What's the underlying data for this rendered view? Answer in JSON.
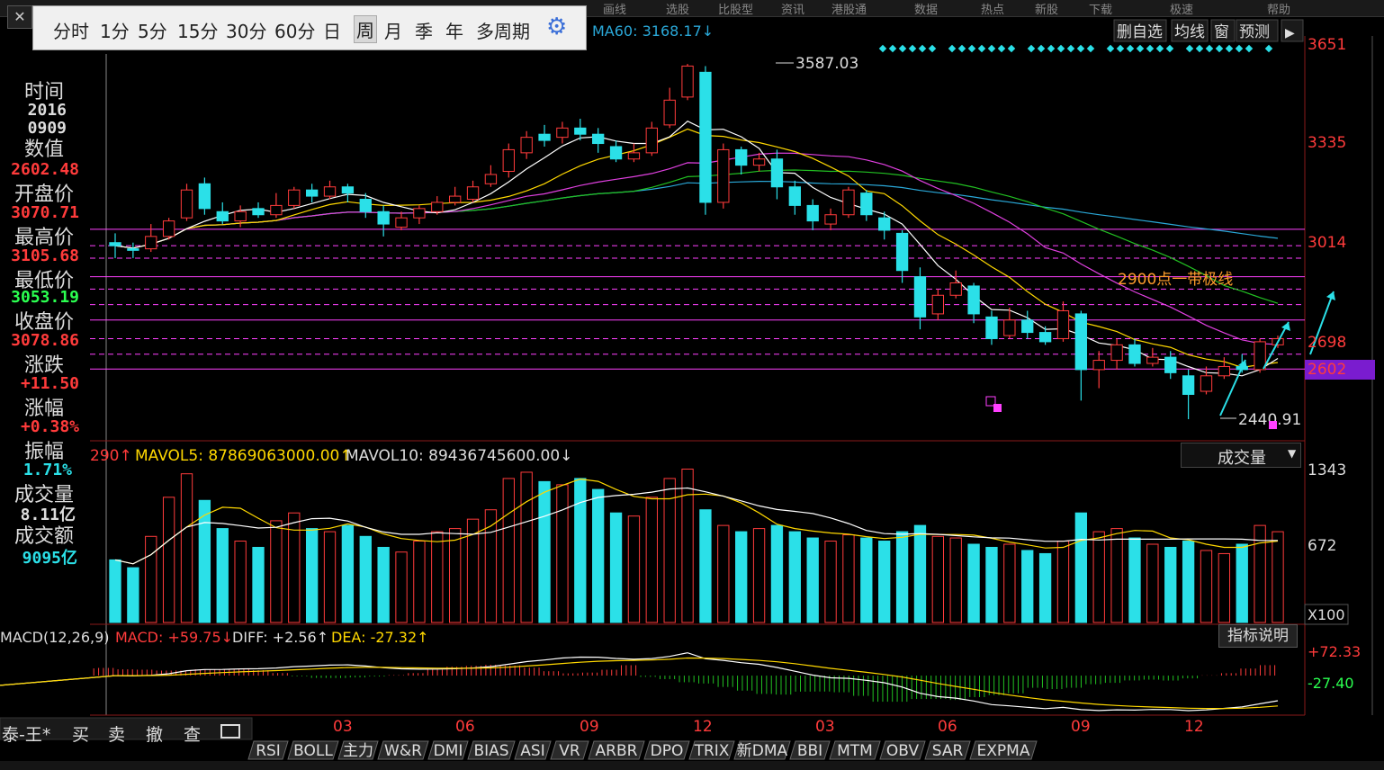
{
  "top_strip": [
    "画线",
    "选股",
    "比股型",
    "资讯",
    "港股通",
    "数据",
    "热点",
    "新股",
    "下载",
    "极速",
    "帮助"
  ],
  "period_bar": {
    "items": [
      "分时",
      "1分",
      "5分",
      "15分",
      "30分",
      "60分",
      "日",
      "周",
      "月",
      "季",
      "年",
      "多周期"
    ],
    "selected": "周",
    "settings_icon": "gear-icon",
    "close_icon": "close-icon"
  },
  "ma_header": {
    "ma60_label": "MA60: 3168.17↓"
  },
  "toolbar": {
    "del_select": "删自选",
    "avg_line": "均线",
    "window": "窗",
    "predict": "预测",
    "expand_icon": "expand-icon"
  },
  "info_panel": {
    "time_label": "时间",
    "year": "2016",
    "date": "0909",
    "value_label": "数值",
    "value": "2602.48",
    "open_label": "开盘价",
    "open": "3070.71",
    "high_label": "最高价",
    "high": "3105.68",
    "low_label": "最低价",
    "low": "3053.19",
    "close_label": "收盘价",
    "close": "3078.86",
    "change_label": "涨跌",
    "change": "+11.50",
    "pct_label": "涨幅",
    "pct": "+0.38%",
    "amp_label": "振幅",
    "amp": "1.71%",
    "vol_label": "成交量",
    "vol": "8.11亿",
    "amt_label": "成交额",
    "amt": "9095亿"
  },
  "price_axis": {
    "ticks": [
      "3651",
      "3335",
      "3014",
      "2698",
      "2602"
    ]
  },
  "annotations": {
    "peak": "3587.03",
    "trough": "2440.91",
    "zone_note": "2900点一带极线"
  },
  "volume_header": {
    "mavol_prev": "290↑",
    "mavol5": "MAVOL5: 87869063000.00↑",
    "mavol10": "MAVOL10: 89436745600.00↓"
  },
  "volume_axis": {
    "ticks": [
      "1343",
      "672"
    ],
    "unit": "X100",
    "selector": "成交量"
  },
  "macd_header": {
    "name": "MACD(12,26,9)",
    "macd": "MACD: +59.75↓",
    "diff": "DIFF: +2.56↑",
    "dea": "DEA: -27.32↑"
  },
  "macd_axis": {
    "ticks": [
      "+72.33",
      "-27.40"
    ],
    "explain": "指标说明"
  },
  "x_axis": {
    "labels": [
      "03",
      "06",
      "09",
      "12",
      "03",
      "06",
      "09",
      "12"
    ]
  },
  "order_bar": [
    "泰-王*",
    "买",
    "卖",
    "撤",
    "查"
  ],
  "indicator_tabs": [
    "RSI",
    "BOLL",
    "主力",
    "W&R",
    "DMI",
    "BIAS",
    "ASI",
    "VR",
    "ARBR",
    "DPO",
    "TRIX",
    "新DMA",
    "BBI",
    "MTM",
    "OBV",
    "SAR",
    "EXPMA"
  ],
  "colors": {
    "up": "#ff3b3b",
    "down": "#2be0e8",
    "ma5": "#ffffff",
    "ma10": "#ffd800",
    "ma20": "#e040e0",
    "ma30": "#22c022",
    "ma60": "#2aa8d8",
    "zone": "#ff40ff"
  },
  "chart_data": {
    "type": "candlestick",
    "title": "",
    "ylim": [
      2440,
      3651
    ],
    "price_levels": [
      3053.19,
      2698,
      2602
    ],
    "candles": [
      {
        "o": 3010,
        "c": 3000,
        "h": 3040,
        "l": 2960
      },
      {
        "o": 2990,
        "c": 2985,
        "h": 3010,
        "l": 2960
      },
      {
        "o": 2990,
        "c": 3030,
        "h": 3070,
        "l": 2980
      },
      {
        "o": 3030,
        "c": 3080,
        "h": 3090,
        "l": 3020
      },
      {
        "o": 3090,
        "c": 3180,
        "h": 3200,
        "l": 3080
      },
      {
        "o": 3200,
        "c": 3120,
        "h": 3220,
        "l": 3100
      },
      {
        "o": 3110,
        "c": 3080,
        "h": 3140,
        "l": 3070
      },
      {
        "o": 3080,
        "c": 3110,
        "h": 3130,
        "l": 3060
      },
      {
        "o": 3120,
        "c": 3100,
        "h": 3140,
        "l": 3090
      },
      {
        "o": 3100,
        "c": 3130,
        "h": 3170,
        "l": 3090
      },
      {
        "o": 3130,
        "c": 3180,
        "h": 3190,
        "l": 3120
      },
      {
        "o": 3180,
        "c": 3160,
        "h": 3200,
        "l": 3140
      },
      {
        "o": 3160,
        "c": 3190,
        "h": 3210,
        "l": 3150
      },
      {
        "o": 3190,
        "c": 3170,
        "h": 3200,
        "l": 3140
      },
      {
        "o": 3150,
        "c": 3110,
        "h": 3170,
        "l": 3090
      },
      {
        "o": 3110,
        "c": 3070,
        "h": 3130,
        "l": 3030
      },
      {
        "o": 3060,
        "c": 3090,
        "h": 3110,
        "l": 3050
      },
      {
        "o": 3090,
        "c": 3120,
        "h": 3130,
        "l": 3070
      },
      {
        "o": 3110,
        "c": 3140,
        "h": 3160,
        "l": 3100
      },
      {
        "o": 3140,
        "c": 3160,
        "h": 3190,
        "l": 3130
      },
      {
        "o": 3150,
        "c": 3190,
        "h": 3210,
        "l": 3140
      },
      {
        "o": 3200,
        "c": 3230,
        "h": 3260,
        "l": 3190
      },
      {
        "o": 3240,
        "c": 3310,
        "h": 3330,
        "l": 3220
      },
      {
        "o": 3300,
        "c": 3350,
        "h": 3370,
        "l": 3280
      },
      {
        "o": 3360,
        "c": 3340,
        "h": 3390,
        "l": 3320
      },
      {
        "o": 3350,
        "c": 3380,
        "h": 3400,
        "l": 3330
      },
      {
        "o": 3380,
        "c": 3360,
        "h": 3410,
        "l": 3340
      },
      {
        "o": 3360,
        "c": 3330,
        "h": 3380,
        "l": 3300
      },
      {
        "o": 3320,
        "c": 3280,
        "h": 3340,
        "l": 3270
      },
      {
        "o": 3280,
        "c": 3300,
        "h": 3330,
        "l": 3270
      },
      {
        "o": 3300,
        "c": 3380,
        "h": 3400,
        "l": 3290
      },
      {
        "o": 3390,
        "c": 3470,
        "h": 3510,
        "l": 3380
      },
      {
        "o": 3480,
        "c": 3580,
        "h": 3587,
        "l": 3470
      },
      {
        "o": 3560,
        "c": 3140,
        "h": 3580,
        "l": 3100
      },
      {
        "o": 3140,
        "c": 3310,
        "h": 3330,
        "l": 3120
      },
      {
        "o": 3310,
        "c": 3260,
        "h": 3320,
        "l": 3230
      },
      {
        "o": 3260,
        "c": 3280,
        "h": 3300,
        "l": 3240
      },
      {
        "o": 3280,
        "c": 3190,
        "h": 3310,
        "l": 3150
      },
      {
        "o": 3190,
        "c": 3130,
        "h": 3210,
        "l": 3100
      },
      {
        "o": 3130,
        "c": 3080,
        "h": 3150,
        "l": 3050
      },
      {
        "o": 3070,
        "c": 3100,
        "h": 3120,
        "l": 3050
      },
      {
        "o": 3100,
        "c": 3180,
        "h": 3190,
        "l": 3090
      },
      {
        "o": 3170,
        "c": 3100,
        "h": 3180,
        "l": 3080
      },
      {
        "o": 3090,
        "c": 3050,
        "h": 3110,
        "l": 3020
      },
      {
        "o": 3040,
        "c": 2920,
        "h": 3050,
        "l": 2880
      },
      {
        "o": 2900,
        "c": 2770,
        "h": 2930,
        "l": 2730
      },
      {
        "o": 2780,
        "c": 2840,
        "h": 2860,
        "l": 2760
      },
      {
        "o": 2840,
        "c": 2880,
        "h": 2920,
        "l": 2830
      },
      {
        "o": 2870,
        "c": 2780,
        "h": 2880,
        "l": 2750
      },
      {
        "o": 2770,
        "c": 2700,
        "h": 2790,
        "l": 2680
      },
      {
        "o": 2710,
        "c": 2760,
        "h": 2800,
        "l": 2700
      },
      {
        "o": 2760,
        "c": 2720,
        "h": 2790,
        "l": 2700
      },
      {
        "o": 2720,
        "c": 2690,
        "h": 2740,
        "l": 2680
      },
      {
        "o": 2700,
        "c": 2790,
        "h": 2820,
        "l": 2690
      },
      {
        "o": 2780,
        "c": 2600,
        "h": 2790,
        "l": 2500
      },
      {
        "o": 2600,
        "c": 2630,
        "h": 2660,
        "l": 2540
      },
      {
        "o": 2630,
        "c": 2680,
        "h": 2700,
        "l": 2600
      },
      {
        "o": 2680,
        "c": 2620,
        "h": 2700,
        "l": 2610
      },
      {
        "o": 2620,
        "c": 2640,
        "h": 2670,
        "l": 2610
      },
      {
        "o": 2640,
        "c": 2590,
        "h": 2660,
        "l": 2570
      },
      {
        "o": 2580,
        "c": 2520,
        "h": 2600,
        "l": 2440
      },
      {
        "o": 2530,
        "c": 2580,
        "h": 2610,
        "l": 2520
      },
      {
        "o": 2580,
        "c": 2610,
        "h": 2640,
        "l": 2570
      },
      {
        "o": 2610,
        "c": 2600,
        "h": 2650,
        "l": 2590
      },
      {
        "o": 2600,
        "c": 2690,
        "h": 2700,
        "l": 2590
      },
      {
        "o": 2680,
        "c": 2700,
        "h": 2710,
        "l": 2670
      }
    ],
    "volume": [
      40,
      35,
      55,
      80,
      95,
      78,
      60,
      52,
      48,
      65,
      70,
      60,
      58,
      62,
      55,
      48,
      45,
      52,
      58,
      60,
      66,
      72,
      92,
      96,
      90,
      88,
      92,
      85,
      70,
      68,
      80,
      92,
      98,
      72,
      62,
      58,
      60,
      62,
      58,
      54,
      52,
      56,
      54,
      52,
      58,
      62,
      55,
      54,
      50,
      48,
      50,
      46,
      44,
      52,
      70,
      58,
      60,
      54,
      50,
      48,
      52,
      46,
      44,
      50,
      62,
      58
    ]
  }
}
